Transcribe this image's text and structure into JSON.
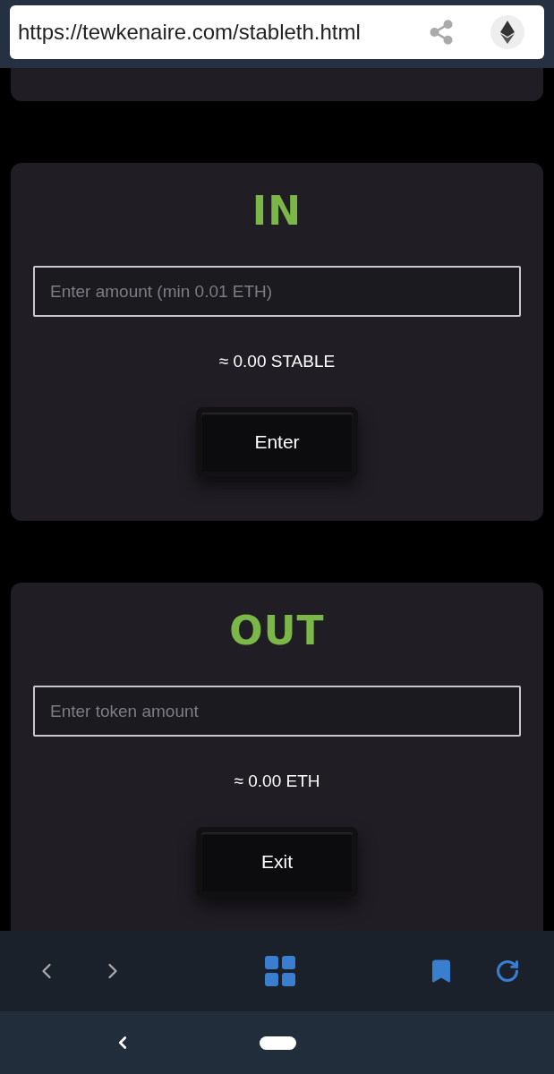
{
  "browser": {
    "url": "https://tewkenaire.com/stableth.html"
  },
  "cards": [
    {
      "title": "IN",
      "placeholder": "Enter amount (min 0.01 ETH)",
      "estimate": "≈ 0.00 STABLE",
      "button": "Enter"
    },
    {
      "title": "OUT",
      "placeholder": "Enter token amount",
      "estimate": "≈ 0.00 ETH",
      "button": "Exit"
    }
  ]
}
